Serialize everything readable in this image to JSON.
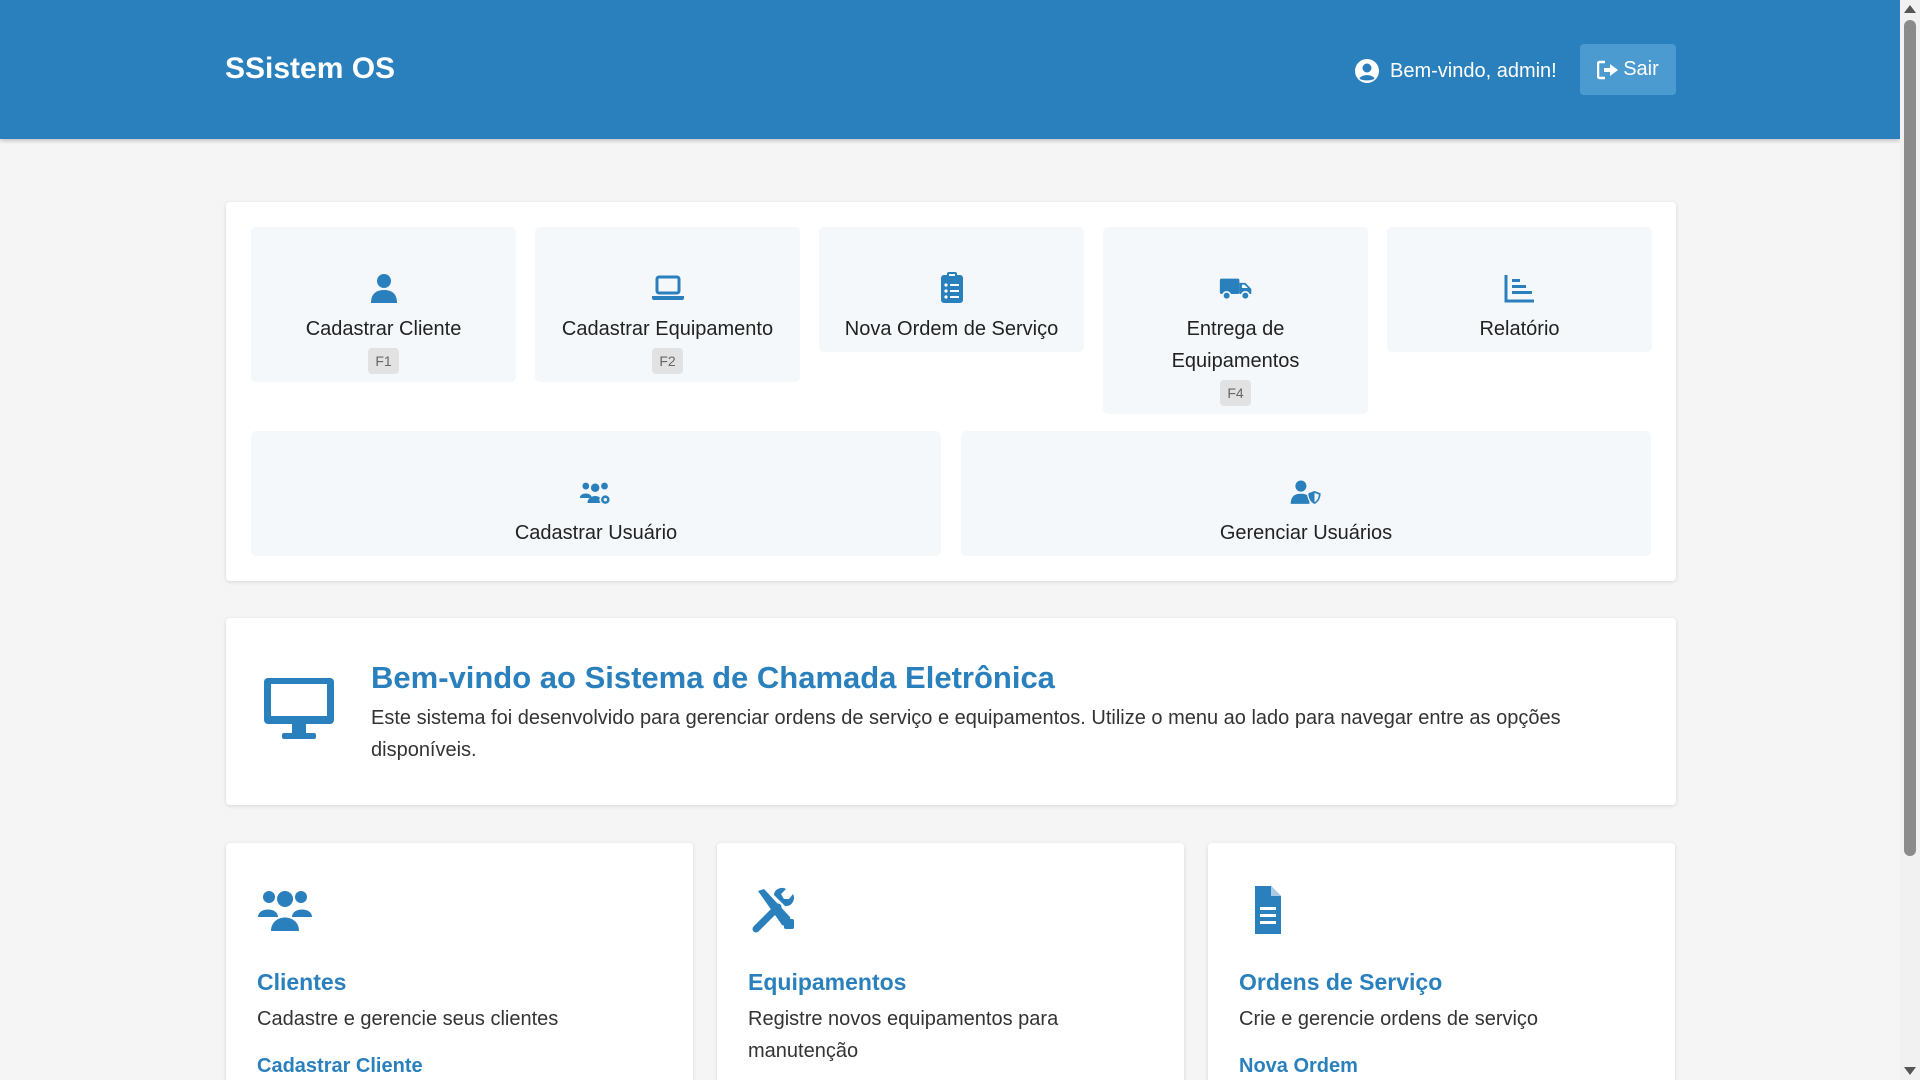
{
  "header": {
    "brand": "SSistem OS",
    "welcome_text": "Bem-vindo, admin!",
    "logout_label": "Sair"
  },
  "quick_actions": [
    {
      "label": "Cadastrar Cliente",
      "shortcut": "F1",
      "icon": "user-icon"
    },
    {
      "label": "Cadastrar Equipamento",
      "shortcut": "F2",
      "icon": "laptop-icon"
    },
    {
      "label": "Nova Ordem de Serviço",
      "shortcut": "",
      "icon": "clipboard-list-icon"
    },
    {
      "label": "Entrega de Equipamentos",
      "shortcut": "F4",
      "icon": "truck-icon"
    },
    {
      "label": "Relatório",
      "shortcut": "",
      "icon": "chart-icon"
    },
    {
      "label": "Cadastrar Usuário",
      "shortcut": "",
      "icon": "users-gear-icon"
    },
    {
      "label": "Gerenciar Usuários",
      "shortcut": "",
      "icon": "user-shield-icon"
    }
  ],
  "welcome": {
    "title": "Bem-vindo ao Sistema de Chamada Eletrônica",
    "text": "Este sistema foi desenvolvido para gerenciar ordens de serviço e equipamentos. Utilize o menu ao lado para navegar entre as opções disponíveis.",
    "icon": "desktop-icon"
  },
  "features": [
    {
      "title": "Clientes",
      "text": "Cadastre e gerencie seus clientes",
      "link": "Cadastrar Cliente",
      "icon": "users-icon"
    },
    {
      "title": "Equipamentos",
      "text": "Registre novos equipamentos para manutenção",
      "link": "",
      "icon": "tools-icon"
    },
    {
      "title": "Ordens de Serviço",
      "text": "Crie e gerencie ordens de serviço",
      "link": "Nova Ordem",
      "icon": "file-icon"
    }
  ],
  "colors": {
    "primary": "#2a80bd",
    "button": "#4c9bd0",
    "tile_bg": "#f5f8fb",
    "page_bg": "#f5f5f5"
  }
}
